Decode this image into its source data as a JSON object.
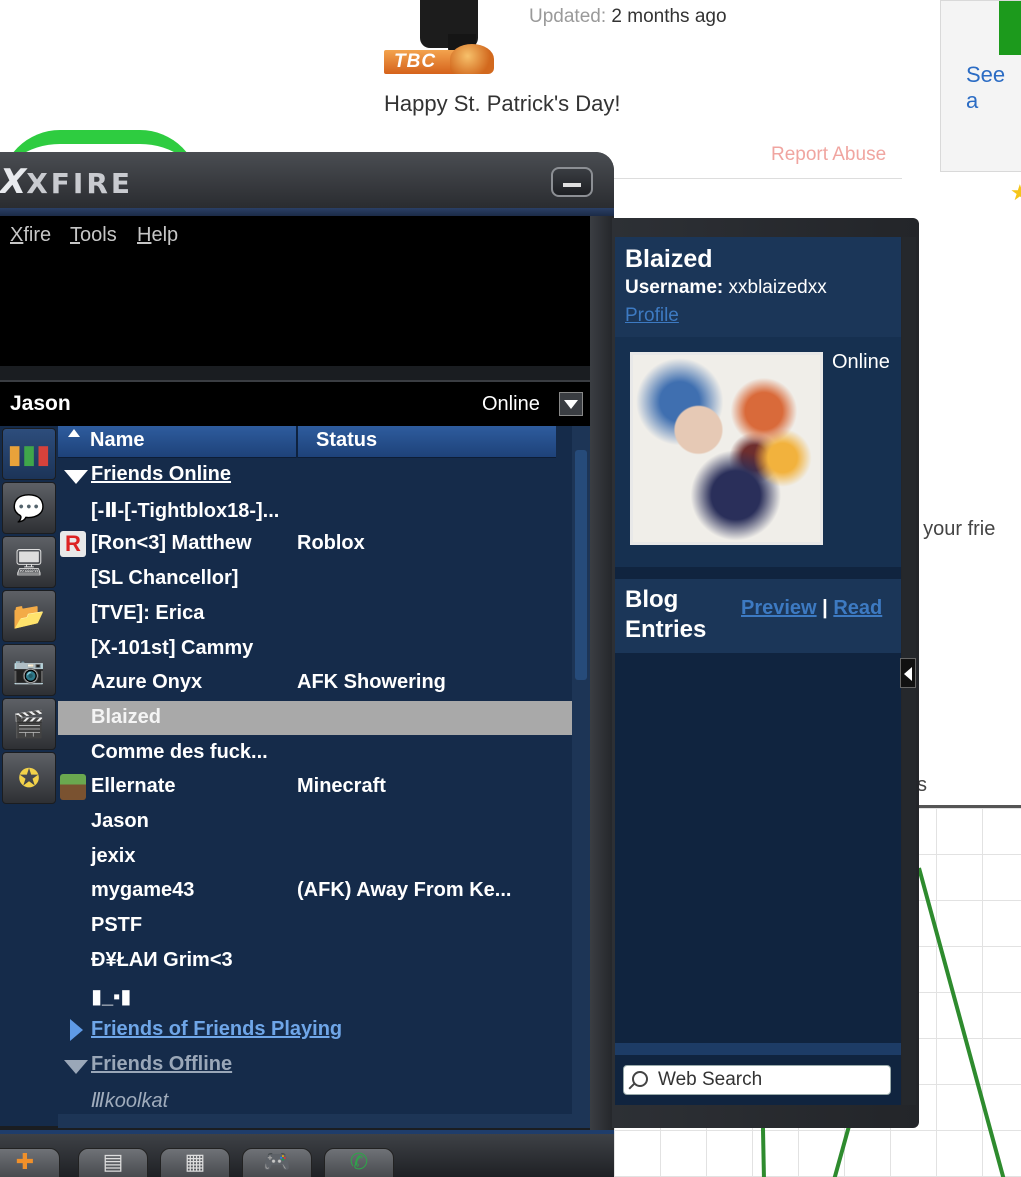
{
  "background": {
    "badge": "TBC",
    "updated_label": "Updated:",
    "updated_value": "2 months ago",
    "status_message": "Happy St. Patrick's Day!",
    "report_abuse": "Report Abuse",
    "see_all": "See a",
    "friends_fragment": "t your frie",
    "s_fragment": "s"
  },
  "xfire": {
    "logo_x": "X",
    "logo_text": "XFIRE",
    "menu": {
      "xfire_first": "X",
      "xfire_rest": "fire",
      "tools_first": "T",
      "tools_rest": "ools",
      "help_first": "H",
      "help_rest": "elp"
    },
    "user": {
      "name": "Jason",
      "status": "Online"
    },
    "columns": {
      "name": "Name",
      "status": "Status"
    },
    "groups": {
      "online": "Friends Online",
      "fof": "Friends of Friends Playing",
      "offline": "Friends Offline"
    },
    "friends": [
      {
        "name": "[-Ⅱ-[-Tightblox18-]...",
        "status": ""
      },
      {
        "name": "[Ron<3] Matthew",
        "status": "Roblox",
        "icon": "roblox-icon"
      },
      {
        "name": "[SL Chancellor]",
        "status": ""
      },
      {
        "name": "[TVE]: Erica",
        "status": ""
      },
      {
        "name": "[X-101st] Cammy",
        "status": ""
      },
      {
        "name": "Azure Onyx",
        "status": "AFK Showering"
      },
      {
        "name": "Blaized",
        "status": "",
        "selected": true
      },
      {
        "name": "Comme des fuck...",
        "status": ""
      },
      {
        "name": "Ellernate",
        "status": "Minecraft",
        "icon": "minecraft-icon"
      },
      {
        "name": "Jason",
        "status": ""
      },
      {
        "name": "jexix",
        "status": ""
      },
      {
        "name": "mygame43",
        "status": "(AFK) Away From Ke..."
      },
      {
        "name": "PSTF",
        "status": ""
      },
      {
        "name": "Đ¥ŁAИ Grim<3",
        "status": ""
      },
      {
        "name": "▮_▪▮",
        "status": ""
      }
    ],
    "offline_friends": [
      {
        "name": "Ⅲkoolkat"
      }
    ]
  },
  "profile": {
    "name": "Blaized",
    "username_label": "Username:",
    "username": "xxblaizedxx",
    "profile_link": "Profile",
    "status": "Online",
    "blog_title_1": "Blog",
    "blog_title_2": "Entries",
    "preview": "Preview",
    "separator": "|",
    "read": "Read",
    "search_label": "Web Search"
  },
  "colors": {
    "panel_bg": "#152b4a",
    "header_blue": "#1e4279",
    "selected_row": "#a9a9a9",
    "link_blue": "#3d7ac2",
    "report_abuse": "#f0a5a0"
  }
}
